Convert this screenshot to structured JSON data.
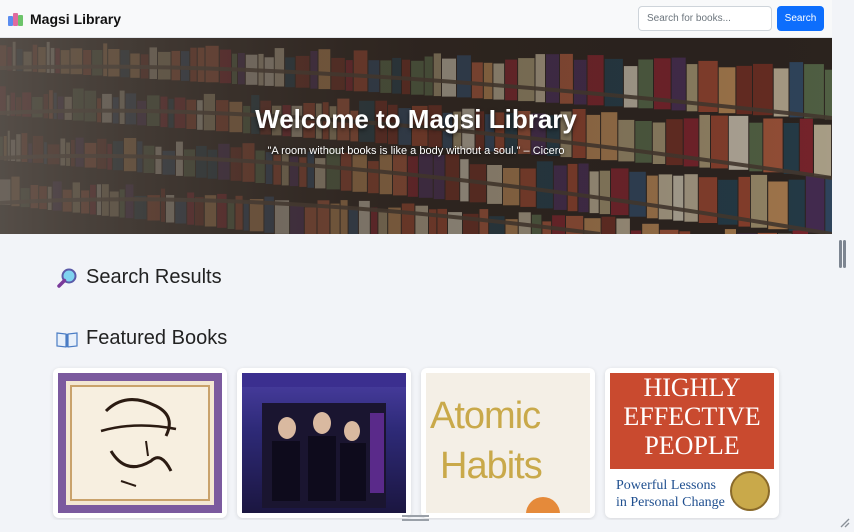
{
  "navbar": {
    "brand": "Magsi Library",
    "brand_icon": "books-icon",
    "search_placeholder": "Search for books...",
    "search_button": "Search"
  },
  "hero": {
    "title": "Welcome to Magsi Library",
    "quote": "\"A room without books is like a body without a soul.\" – Cicero"
  },
  "sections": {
    "search_results": {
      "icon": "magnifying-glass-icon",
      "title": "Search Results"
    },
    "featured": {
      "icon": "open-book-icon",
      "title": "Featured Books"
    }
  },
  "featured_books": [
    {
      "cover": "Quran cover art",
      "cover_text": ""
    },
    {
      "cover": "Harry Potter cover art",
      "cover_text": ""
    },
    {
      "cover": "Atomic Habits",
      "cover_text_1": "Atomic",
      "cover_text_2": "Habits"
    },
    {
      "cover": "7 Habits",
      "cover_text_1": "HIGHLY",
      "cover_text_2": "EFFECTIVE",
      "cover_text_3": "PEOPLE",
      "cover_text_4": "Powerful Lessons",
      "cover_text_5": "in Personal Change"
    }
  ],
  "colors": {
    "primary": "#0d6efd",
    "navbar_bg": "#f8f9fa",
    "page_bg": "#f2f4f8"
  }
}
